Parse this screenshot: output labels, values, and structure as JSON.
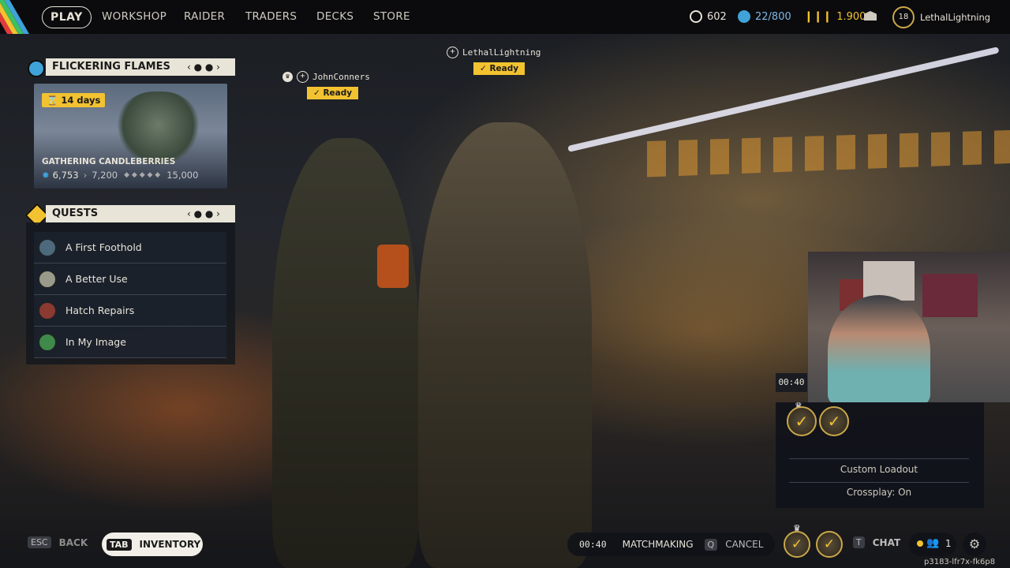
{
  "nav": {
    "play": "PLAY",
    "workshop": "WORKSHOP",
    "raider": "RAIDER",
    "traders": "TRADERS",
    "decks": "DECKS",
    "store": "STORE"
  },
  "currency": {
    "coins": "602",
    "capacity": "22/800",
    "premium": "1.900"
  },
  "profile": {
    "level": "18",
    "username": "LethalLightning"
  },
  "event": {
    "title": "FLICKERING FLAMES",
    "days": "14 days",
    "name": "GATHERING CANDLEBERRIES",
    "current": "6,753",
    "next": "7,200",
    "max": "15,000"
  },
  "quests": {
    "title": "QUESTS",
    "items": [
      {
        "label": "A First Foothold"
      },
      {
        "label": "A Better Use"
      },
      {
        "label": "Hatch Repairs"
      },
      {
        "label": "In My Image"
      }
    ]
  },
  "players": {
    "p1_name": "JohnConners",
    "p1_status": "Ready",
    "p2_name": "LethalLightning",
    "p2_status": "Ready"
  },
  "party": {
    "timer": "00:40",
    "loadout": "Custom Loadout",
    "crossplay": "Crossplay: On"
  },
  "bottom": {
    "esc_key": "ESC",
    "back": "BACK",
    "tab_key": "TAB",
    "inventory": "INVENTORY",
    "timer": "00:40",
    "matchmaking": "MATCHMAKING",
    "q_key": "Q",
    "cancel": "CANCEL",
    "t_key": "T",
    "chat": "CHAT",
    "party_count": "1",
    "session_id": "p3183-lfr7x-fk6p8"
  },
  "colors": {
    "accent_yellow": "#f2c230",
    "panel_light": "#e8e4d8",
    "gear_blue": "#3fa2d8"
  }
}
